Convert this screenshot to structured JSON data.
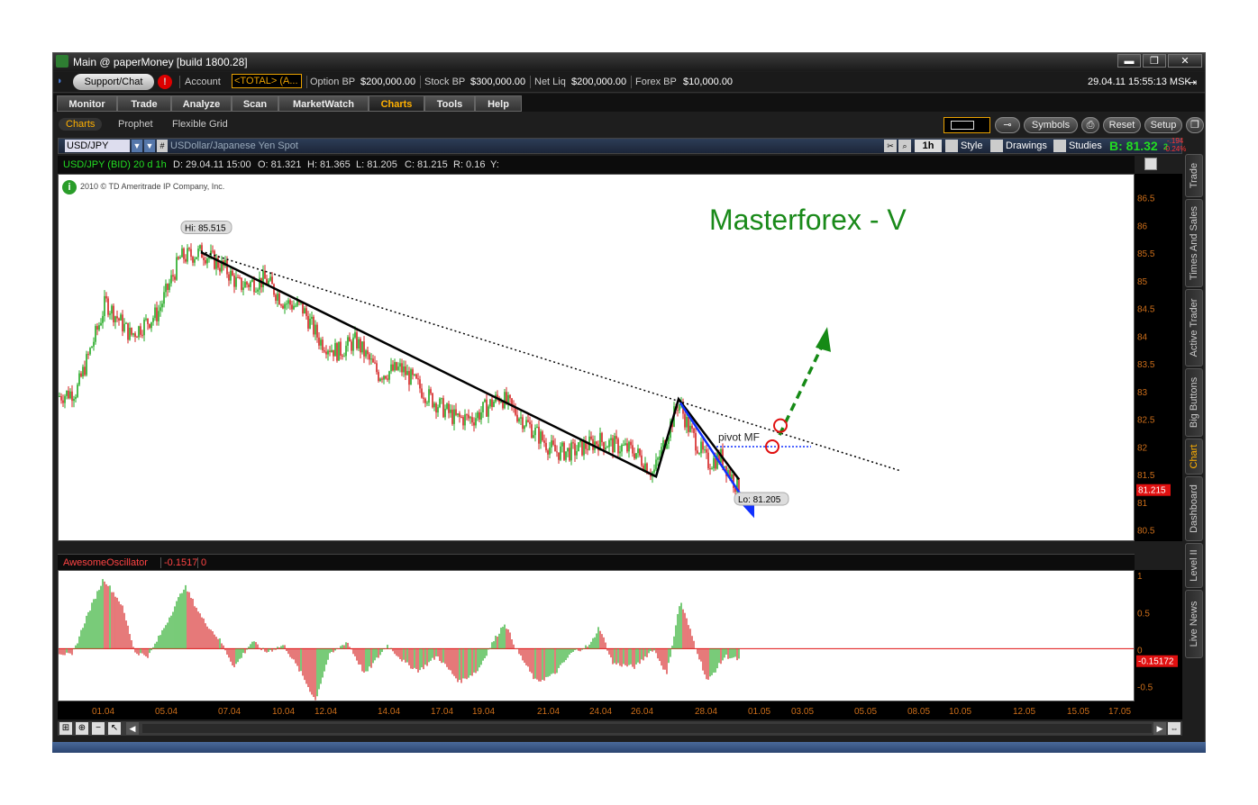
{
  "window": {
    "title": "Main @ paperMoney [build 1800.28]",
    "controls": [
      "▬",
      "❐",
      "✕"
    ]
  },
  "account_bar": {
    "support_label": "Support/Chat",
    "alert_label": "!",
    "account_label": "Account",
    "account_value": "<TOTAL> (A...",
    "option_bp_label": "Option BP",
    "option_bp_value": "$200,000.00",
    "stock_bp_label": "Stock BP",
    "stock_bp_value": "$300,000.00",
    "net_liq_label": "Net Liq",
    "net_liq_value": "$200,000.00",
    "forex_bp_label": "Forex BP",
    "forex_bp_value": "$10,000.00",
    "datetime": "29.04.11 15:55:13 MSK"
  },
  "nav": {
    "tabs": [
      {
        "label": "Monitor",
        "active": false
      },
      {
        "label": "Trade",
        "active": false
      },
      {
        "label": "Analyze",
        "active": false
      },
      {
        "label": "Scan",
        "active": false
      },
      {
        "label": "MarketWatch",
        "active": false
      },
      {
        "label": "Charts",
        "active": true
      },
      {
        "label": "Tools",
        "active": false
      },
      {
        "label": "Help",
        "active": false
      }
    ]
  },
  "subnav": {
    "tabs": [
      "Charts",
      "Prophet",
      "Flexible Grid"
    ],
    "buttons": {
      "symbols": "Symbols",
      "reset": "Reset",
      "setup": "Setup"
    }
  },
  "symbol_bar": {
    "symbol": "USD/JPY",
    "description": "USDollar/Japanese Yen Spot",
    "timeframe": "1h",
    "style_label": "Style",
    "drawings_label": "Drawings",
    "studies_label": "Studies",
    "bid_label": "B: 81.32",
    "bid_small": "2",
    "change_abs": "-.194",
    "change_pct": "-0.24%"
  },
  "info_bar": {
    "title": "USD/JPY (BID) 20 d 1h",
    "date": "D: 29.04.11 15:00",
    "open": "O: 81.321",
    "high": "H: 81.365",
    "low": "L: 81.205",
    "close": "C: 81.215",
    "range": "R: 0.16",
    "y": "Y:"
  },
  "chart_annotations": {
    "copyright": "2010 © TD Ameritrade IP Company, Inc.",
    "headline": "Masterforex - V",
    "pivot_label": "pivot MF",
    "high_label": "Hi: 85.515",
    "low_label": "Lo: 81.205",
    "last_price": "81.215"
  },
  "oscillator": {
    "name": "AwesomeOscillator",
    "value": "-0.1517",
    "extra": "0",
    "last_value": "-0.15172",
    "ticks": [
      "1",
      "0.5",
      "0",
      "-0.5"
    ]
  },
  "price_ticks": [
    "86.5",
    "86",
    "85.5",
    "85",
    "84.5",
    "84",
    "83.5",
    "83",
    "82.5",
    "82",
    "81.5",
    "81",
    "80.5"
  ],
  "date_ticks": [
    "01.04",
    "05.04",
    "07.04",
    "10.04",
    "12.04",
    "14.04",
    "17.04",
    "19.04",
    "21.04",
    "24.04",
    "26.04",
    "28.04",
    "01.05",
    "03.05",
    "05.05",
    "08.05",
    "10.05",
    "12.05",
    "15.05",
    "17.05"
  ],
  "side_tabs": [
    {
      "label": "Trade",
      "active": false
    },
    {
      "label": "Times And Sales",
      "active": false
    },
    {
      "label": "Active Trader",
      "active": false
    },
    {
      "label": "Big Buttons",
      "active": false
    },
    {
      "label": "Chart",
      "active": true
    },
    {
      "label": "Dashboard",
      "active": false
    },
    {
      "label": "Level II",
      "active": false
    },
    {
      "label": "Live News",
      "active": false
    }
  ],
  "chart_data": {
    "type": "candlestick",
    "symbol": "USD/JPY",
    "interval": "1h",
    "ylim": [
      80.3,
      86.9
    ],
    "x": [
      "01.04",
      "02.04",
      "04.04",
      "05.04",
      "06.04",
      "07.04",
      "08.04",
      "10.04",
      "11.04",
      "12.04",
      "13.04",
      "14.04",
      "15.04",
      "17.04",
      "18.04",
      "19.04",
      "20.04",
      "21.04",
      "22.04",
      "24.04",
      "25.04",
      "26.04",
      "27.04",
      "28.04",
      "29.04"
    ],
    "close": [
      82.9,
      84.4,
      84.2,
      85.3,
      85.1,
      84.8,
      84.9,
      84.5,
      84.2,
      83.8,
      83.6,
      83.5,
      83.2,
      82.6,
      82.4,
      82.5,
      82.1,
      81.8,
      81.9,
      82.1,
      81.9,
      81.8,
      82.7,
      82.0,
      81.215
    ],
    "oscillator": [
      0.05,
      0.6,
      0.4,
      0.55,
      0.3,
      0.5,
      0.2,
      0.1,
      -0.2,
      -0.35,
      -0.1,
      -0.2,
      -0.15,
      -0.25,
      -0.2,
      0.25,
      -0.1,
      -0.3,
      -0.25,
      0.1,
      0.0,
      -0.1,
      0.6,
      -0.1,
      -0.15
    ],
    "high": {
      "label": "Hi: 85.515",
      "value": 85.515
    },
    "low": {
      "label": "Lo: 81.205",
      "value": 81.205
    }
  }
}
